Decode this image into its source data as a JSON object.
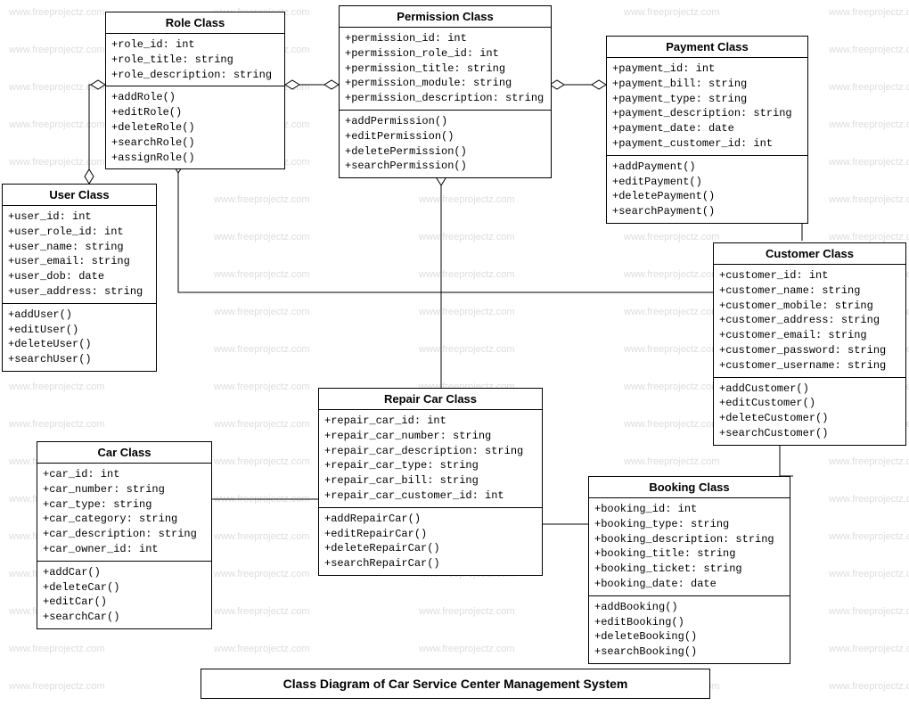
{
  "title": "Class Diagram of Car Service Center Management System",
  "watermark": "www.freeprojectz.com",
  "classes": {
    "role": {
      "name": "Role Class",
      "attributes": [
        "+role_id: int",
        "+role_title: string",
        "+role_description: string"
      ],
      "methods": [
        "+addRole()",
        "+editRole()",
        "+deleteRole()",
        "+searchRole()",
        "+assignRole()"
      ]
    },
    "permission": {
      "name": "Permission Class",
      "attributes": [
        "+permission_id: int",
        "+permission_role_id: int",
        "+permission_title: string",
        "+permission_module: string",
        "+permission_description: string"
      ],
      "methods": [
        "+addPermission()",
        "+editPermission()",
        "+deletePermission()",
        "+searchPermission()"
      ]
    },
    "payment": {
      "name": "Payment Class",
      "attributes": [
        "+payment_id: int",
        "+payment_bill: string",
        "+payment_type: string",
        "+payment_description: string",
        "+payment_date: date",
        "+payment_customer_id: int"
      ],
      "methods": [
        "+addPayment()",
        "+editPayment()",
        "+deletePayment()",
        "+searchPayment()"
      ]
    },
    "user": {
      "name": "User Class",
      "attributes": [
        "+user_id: int",
        "+user_role_id: int",
        "+user_name: string",
        "+user_email: string",
        "+user_dob: date",
        "+user_address: string"
      ],
      "methods": [
        "+addUser()",
        "+editUser()",
        "+deleteUser()",
        "+searchUser()"
      ]
    },
    "customer": {
      "name": "Customer Class",
      "attributes": [
        "+customer_id: int",
        "+customer_name: string",
        "+customer_mobile: string",
        "+customer_address: string",
        "+customer_email: string",
        "+customer_password: string",
        "+customer_username: string"
      ],
      "methods": [
        "+addCustomer()",
        "+editCustomer()",
        "+deleteCustomer()",
        "+searchCustomer()"
      ]
    },
    "repaircar": {
      "name": "Repair Car Class",
      "attributes": [
        "+repair_car_id: int",
        "+repair_car_number: string",
        "+repair_car_description: string",
        "+repair_car_type: string",
        "+repair_car_bill: string",
        "+repair_car_customer_id: int"
      ],
      "methods": [
        "+addRepairCar()",
        "+editRepairCar()",
        "+deleteRepairCar()",
        "+searchRepairCar()"
      ]
    },
    "car": {
      "name": "Car Class",
      "attributes": [
        "+car_id: int",
        "+car_number: string",
        "+car_type: string",
        "+car_category: string",
        "+car_description: string",
        "+car_owner_id: int"
      ],
      "methods": [
        "+addCar()",
        "+deleteCar()",
        "+editCar()",
        "+searchCar()"
      ]
    },
    "booking": {
      "name": "Booking Class",
      "attributes": [
        "+booking_id: int",
        "+booking_type: string",
        "+booking_description: string",
        "+booking_title: string",
        "+booking_ticket: string",
        "+booking_date: date"
      ],
      "methods": [
        "+addBooking()",
        "+editBooking()",
        "+deleteBooking()",
        "+searchBooking()"
      ]
    }
  }
}
